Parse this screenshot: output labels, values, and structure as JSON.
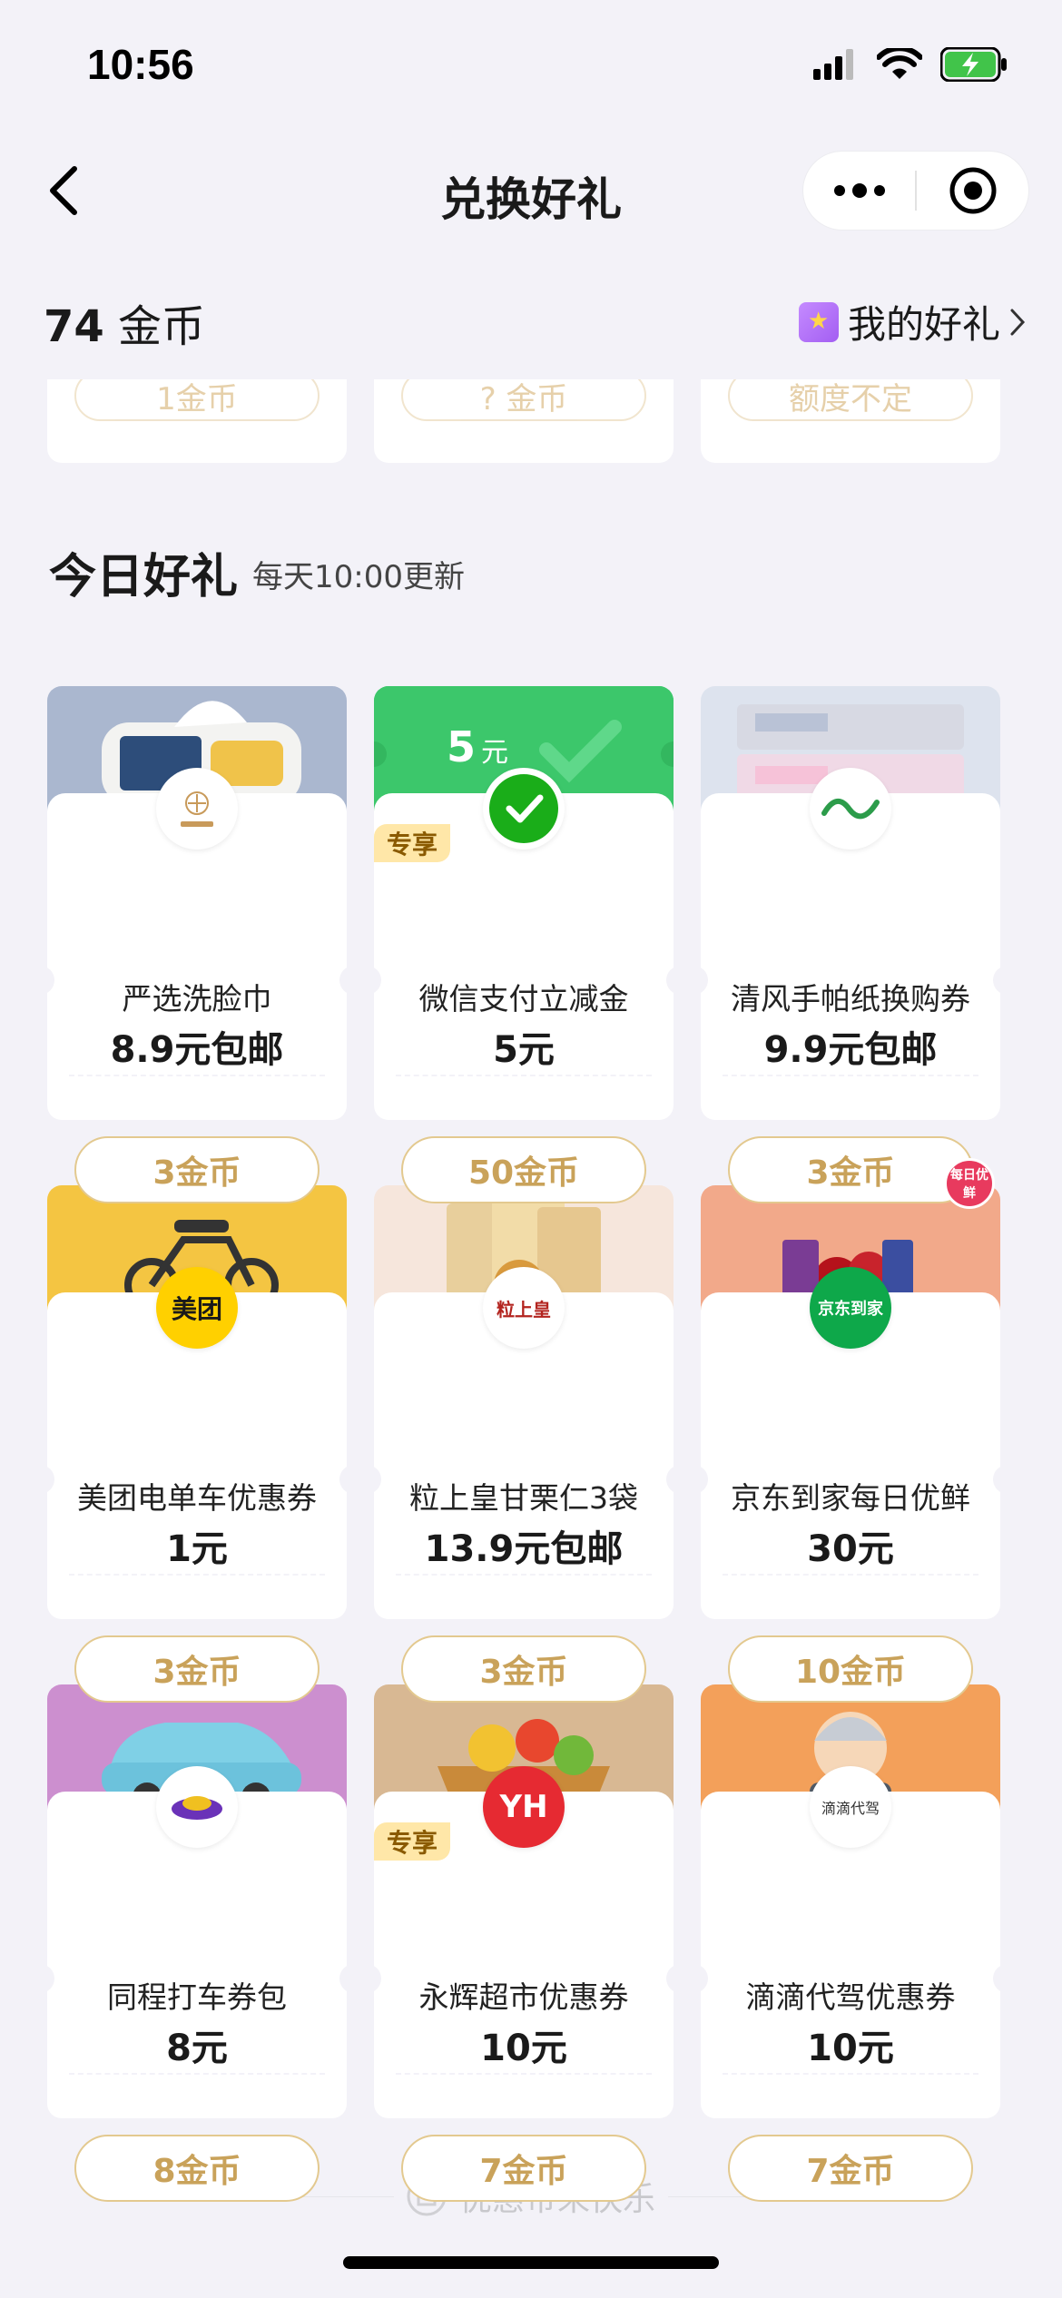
{
  "status_bar": {
    "time": "10:56"
  },
  "nav": {
    "title": "兑换好礼"
  },
  "account": {
    "coin_number": "74",
    "coin_unit": " 金币",
    "my_gifts_label": "我的好礼"
  },
  "previous_row": [
    "1金币",
    "? 金币",
    "额度不定"
  ],
  "section": {
    "title": "今日好礼",
    "subtitle": "每天10:00更新"
  },
  "gifts": [
    {
      "name": "严选洗脸巾",
      "price": "8.9元包邮",
      "cost": "3金币",
      "brand": "网易严选",
      "top_color": "#aab7cf"
    },
    {
      "name": "微信支付立减金",
      "price": "5元",
      "cost": "50金币",
      "brand": "wechat-pay",
      "top_color": "#3cc76b",
      "badge": "专享",
      "banner": "5",
      "banner_unit": "元"
    },
    {
      "name": "清风手帕纸换购券",
      "price": "9.9元包邮",
      "cost": "3金币",
      "brand": "清风",
      "top_color": "#dde3ee"
    },
    {
      "name": "美团电单车优惠券",
      "price": "1元",
      "cost": "3金币",
      "brand": "美团",
      "top_color": "#f4c542"
    },
    {
      "name": "粒上皇甘栗仁3袋",
      "price": "13.9元包邮",
      "cost": "3金币",
      "brand": "粒上皇",
      "top_color": "#f6e6dc"
    },
    {
      "name": "京东到家每日优鲜",
      "price": "30元",
      "cost": "10金币",
      "brand": "京东到家",
      "top_color": "#f2a98a",
      "sticker": "每日优鲜"
    },
    {
      "name": "同程打车券包",
      "price": "8元",
      "cost": "8金币",
      "brand": "同程",
      "top_color": "#cc8fcf"
    },
    {
      "name": "永辉超市优惠券",
      "price": "10元",
      "cost": "7金币",
      "brand": "YH",
      "top_color": "#d8b893",
      "badge": "专享"
    },
    {
      "name": "滴滴代驾优惠券",
      "price": "10元",
      "cost": "7金币",
      "brand": "滴滴代驾",
      "top_color": "#f3a05a"
    }
  ],
  "footer": {
    "text": "优惠带来快乐"
  },
  "colors": {
    "accent_gold": "#c9a25a",
    "page_bg": "#f3f2f8",
    "wechat_green": "#3cc76b"
  }
}
